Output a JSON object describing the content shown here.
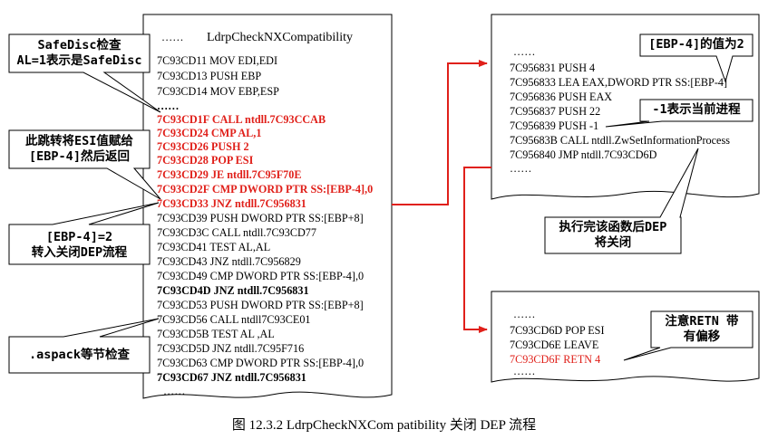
{
  "main_listing": {
    "top_dots": "……",
    "title": "LdrpCheckNXCompatibility",
    "lines": [
      {
        "text": "7C93CD11    MOV EDI,EDI",
        "style": "normal"
      },
      {
        "text": "7C93CD13    PUSH EBP",
        "style": "normal"
      },
      {
        "text": "7C93CD14    MOV EBP,ESP",
        "style": "normal"
      },
      {
        "text": "……",
        "style": "normal"
      },
      {
        "text": "7C93CD1F    CALL ntdll.7C93CCAB",
        "style": "red"
      },
      {
        "text": "7C93CD24    CMP AL,1",
        "style": "red"
      },
      {
        "text": "7C93CD26    PUSH 2",
        "style": "red"
      },
      {
        "text": "7C93CD28    POP ESI",
        "style": "red"
      },
      {
        "text": "7C93CD29    JE ntdll.7C95F70E",
        "style": "red"
      },
      {
        "text": "7C93CD2F    CMP DWORD PTR SS:[EBP-4],0",
        "style": "red"
      },
      {
        "text": "7C93CD33    JNZ ntdll.7C956831",
        "style": "red"
      },
      {
        "text": "7C93CD39   PUSH DWORD PTR SS:[EBP+8]",
        "style": "normal"
      },
      {
        "text": "7C93CD3C    CALL ntdll.7C93CD77",
        "style": "normal"
      },
      {
        "text": "7C93CD41    TEST AL,AL",
        "style": "normal"
      },
      {
        "text": "7C93CD43    JNZ ntdll.7C956829",
        "style": "normal"
      },
      {
        "text": "7C93CD49    CMP DWORD PTR SS:[EBP-4],0",
        "style": "normal"
      },
      {
        "text": "7C93CD4D    JNZ ntdll.7C956831",
        "style": "bold"
      },
      {
        "text": "7C93CD53    PUSH DWORD PTR SS:[EBP+8]",
        "style": "normal"
      },
      {
        "text": "7C93CD56    CALL ntdll7C93CE01",
        "style": "normal"
      },
      {
        "text": "7C93CD5B    TEST AL ,AL",
        "style": "normal"
      },
      {
        "text": "7C93CD5D    JNZ ntdll.7C95F716",
        "style": "normal"
      },
      {
        "text": "7C93CD63    CMP DWORD PTR SS:[EBP-4],0",
        "style": "normal"
      },
      {
        "text": "7C93CD67    JNZ ntdll.7C956831",
        "style": "bold"
      },
      {
        "text": "……",
        "style": "normal"
      }
    ]
  },
  "right_top_listing": {
    "lines": [
      {
        "text": "……",
        "style": "normal"
      },
      {
        "text": "7C956831   PUSH 4",
        "style": "normal"
      },
      {
        "text": "7C956833   LEA EAX,DWORD PTR SS:[EBP-4]",
        "style": "normal"
      },
      {
        "text": "7C956836   PUSH EAX",
        "style": "normal"
      },
      {
        "text": "7C956837   PUSH 22",
        "style": "normal"
      },
      {
        "text": "7C956839   PUSH -1",
        "style": "normal"
      },
      {
        "text": "7C95683B   CALL ntdll.ZwSetInformationProcess",
        "style": "normal"
      },
      {
        "text": "7C956840   JMP ntdll.7C93CD6D",
        "style": "normal"
      },
      {
        "text": "……",
        "style": "normal"
      }
    ]
  },
  "right_bottom_listing": {
    "lines": [
      {
        "text": "……",
        "style": "normal"
      },
      {
        "text": "7C93CD6D   POP ESI",
        "style": "normal"
      },
      {
        "text": "7C93CD6E   LEAVE",
        "style": "normal"
      },
      {
        "text": "7C93CD6F   RETN 4",
        "style": "redplain"
      },
      {
        "text": "……",
        "style": "normal"
      }
    ]
  },
  "callouts": {
    "safedisc": {
      "line1": "SafeDisc检查",
      "line2": "AL=1表示是SafeDisc"
    },
    "jump_esi": {
      "line1": "此跳转将ESI值赋给",
      "line2": "[EBP-4]然后返回"
    },
    "ebp_eq_2": {
      "line1": "[EBP-4]=2",
      "line2": "转入关闭DEP流程"
    },
    "aspack": {
      "line1": ".aspack等节检查"
    },
    "value_is_2": {
      "line1": "[EBP-4]的值为2"
    },
    "current_process": {
      "line1": "-1表示当前进程"
    },
    "dep_closed": {
      "line1": "执行完该函数后DEP",
      "line2": "将关闭"
    },
    "retn_offset": {
      "line1": "注意RETN 带",
      "line2": "有偏移"
    }
  },
  "caption": "图 12.3.2  LdrpCheckNXCom  patibility 关闭 DEP 流程",
  "colors": {
    "accent_red": "#e0201a",
    "text": "#000000",
    "background": "#ffffff"
  }
}
